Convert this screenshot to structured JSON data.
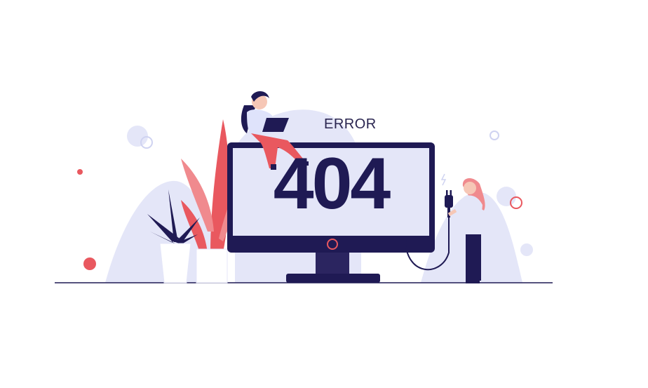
{
  "illustration": {
    "title_word": "ERROR",
    "status_code": "404",
    "colors": {
      "navy": "#1f1a54",
      "lavender": "#e4e6f8",
      "lavender_dark": "#cfd3f1",
      "coral": "#e9585f",
      "pink": "#f08a8e",
      "white": "#ffffff"
    },
    "icons": [
      "monitor-icon",
      "plant-icon",
      "person-laptop-icon",
      "person-plug-icon",
      "plug-icon",
      "lightning-icon"
    ]
  }
}
